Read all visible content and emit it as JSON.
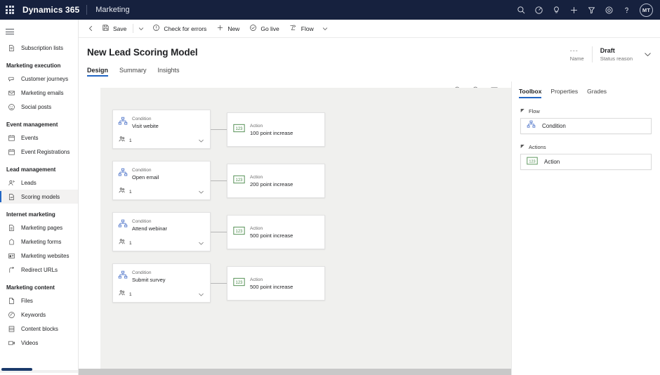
{
  "brandbar": {
    "waffle_label": "waffle",
    "product": "Dynamics 365",
    "app": "Marketing",
    "icons": [
      {
        "name": "search-icon"
      },
      {
        "name": "diagnostics-icon"
      },
      {
        "name": "lightbulb-icon"
      },
      {
        "name": "add-icon"
      },
      {
        "name": "filter-icon"
      },
      {
        "name": "settings-gear-icon"
      },
      {
        "name": "help-icon"
      }
    ],
    "avatar_initials": "MT"
  },
  "sidebar": {
    "items": [
      {
        "label": "Subscription lists",
        "icon": "subscription-lists-icon",
        "type": "item",
        "selected": false
      },
      {
        "label": "Marketing execution",
        "type": "group"
      },
      {
        "label": "Customer journeys",
        "icon": "customer-journeys-icon",
        "type": "item",
        "selected": false
      },
      {
        "label": "Marketing emails",
        "icon": "marketing-emails-icon",
        "type": "item",
        "selected": false
      },
      {
        "label": "Social posts",
        "icon": "social-posts-icon",
        "type": "item",
        "selected": false
      },
      {
        "label": "Event management",
        "type": "group"
      },
      {
        "label": "Events",
        "icon": "events-icon",
        "type": "item",
        "selected": false
      },
      {
        "label": "Event Registrations",
        "icon": "event-registrations-icon",
        "type": "item",
        "selected": false
      },
      {
        "label": "Lead management",
        "type": "group"
      },
      {
        "label": "Leads",
        "icon": "leads-icon",
        "type": "item",
        "selected": false
      },
      {
        "label": "Scoring models",
        "icon": "scoring-models-icon",
        "type": "item",
        "selected": true
      },
      {
        "label": "Internet marketing",
        "type": "group"
      },
      {
        "label": "Marketing pages",
        "icon": "marketing-pages-icon",
        "type": "item",
        "selected": false
      },
      {
        "label": "Marketing forms",
        "icon": "marketing-forms-icon",
        "type": "item",
        "selected": false
      },
      {
        "label": "Marketing websites",
        "icon": "marketing-websites-icon",
        "type": "item",
        "selected": false
      },
      {
        "label": "Redirect URLs",
        "icon": "redirect-urls-icon",
        "type": "item",
        "selected": false
      },
      {
        "label": "Marketing content",
        "type": "group"
      },
      {
        "label": "Files",
        "icon": "files-icon",
        "type": "item",
        "selected": false
      },
      {
        "label": "Keywords",
        "icon": "keywords-icon",
        "type": "item",
        "selected": false
      },
      {
        "label": "Content blocks",
        "icon": "content-blocks-icon",
        "type": "item",
        "selected": false
      },
      {
        "label": "Videos",
        "icon": "videos-icon",
        "type": "item",
        "selected": false
      }
    ]
  },
  "command_bar": {
    "back_label": "Back",
    "save_label": "Save",
    "check_errors_label": "Check for errors",
    "new_label": "New",
    "go_live_label": "Go live",
    "flow_label": "Flow"
  },
  "page_header": {
    "title": "New Lead Scoring Model",
    "tabs": [
      {
        "label": "Design",
        "active": true
      },
      {
        "label": "Summary",
        "active": false
      },
      {
        "label": "Insights",
        "active": false
      }
    ],
    "stats": [
      {
        "value": "---",
        "label": "Name",
        "dim": true
      },
      {
        "value": "Draft",
        "label": "Status reason",
        "dim": false
      }
    ]
  },
  "canvas": {
    "toolbar": [
      {
        "name": "zoom-out-icon"
      },
      {
        "name": "zoom-in-icon"
      },
      {
        "name": "fit-to-screen-icon"
      }
    ],
    "pairs": [
      {
        "condition": {
          "kind": "Condition",
          "name": "Visit webite",
          "count": "1"
        },
        "action": {
          "kind": "Action",
          "name": "100 point increase",
          "badge": "123"
        }
      },
      {
        "condition": {
          "kind": "Condition",
          "name": "Open email",
          "count": "1"
        },
        "action": {
          "kind": "Action",
          "name": "200 point increase",
          "badge": "123"
        }
      },
      {
        "condition": {
          "kind": "Condition",
          "name": "Attend webinar",
          "count": "1"
        },
        "action": {
          "kind": "Action",
          "name": "500 point increase",
          "badge": "123"
        }
      },
      {
        "condition": {
          "kind": "Condition",
          "name": "Submit survey",
          "count": "1"
        },
        "action": {
          "kind": "Action",
          "name": "500 point increase",
          "badge": "123"
        }
      }
    ]
  },
  "toolbox": {
    "tabs": [
      {
        "label": "Toolbox",
        "active": true
      },
      {
        "label": "Properties",
        "active": false
      },
      {
        "label": "Grades",
        "active": false
      }
    ],
    "sections": [
      {
        "title": "Flow",
        "items": [
          {
            "label": "Condition",
            "icon": "condition-icon"
          }
        ]
      },
      {
        "title": "Actions",
        "items": [
          {
            "label": "Action",
            "icon": "action-number-icon"
          }
        ]
      }
    ]
  },
  "colors": {
    "brandbar_bg": "#16213e",
    "accent": "#2266c4",
    "canvas_bg": "#f0f0ee",
    "condition_icon": "#5b7ecd",
    "action_badge_border": "#4b8a4b"
  }
}
